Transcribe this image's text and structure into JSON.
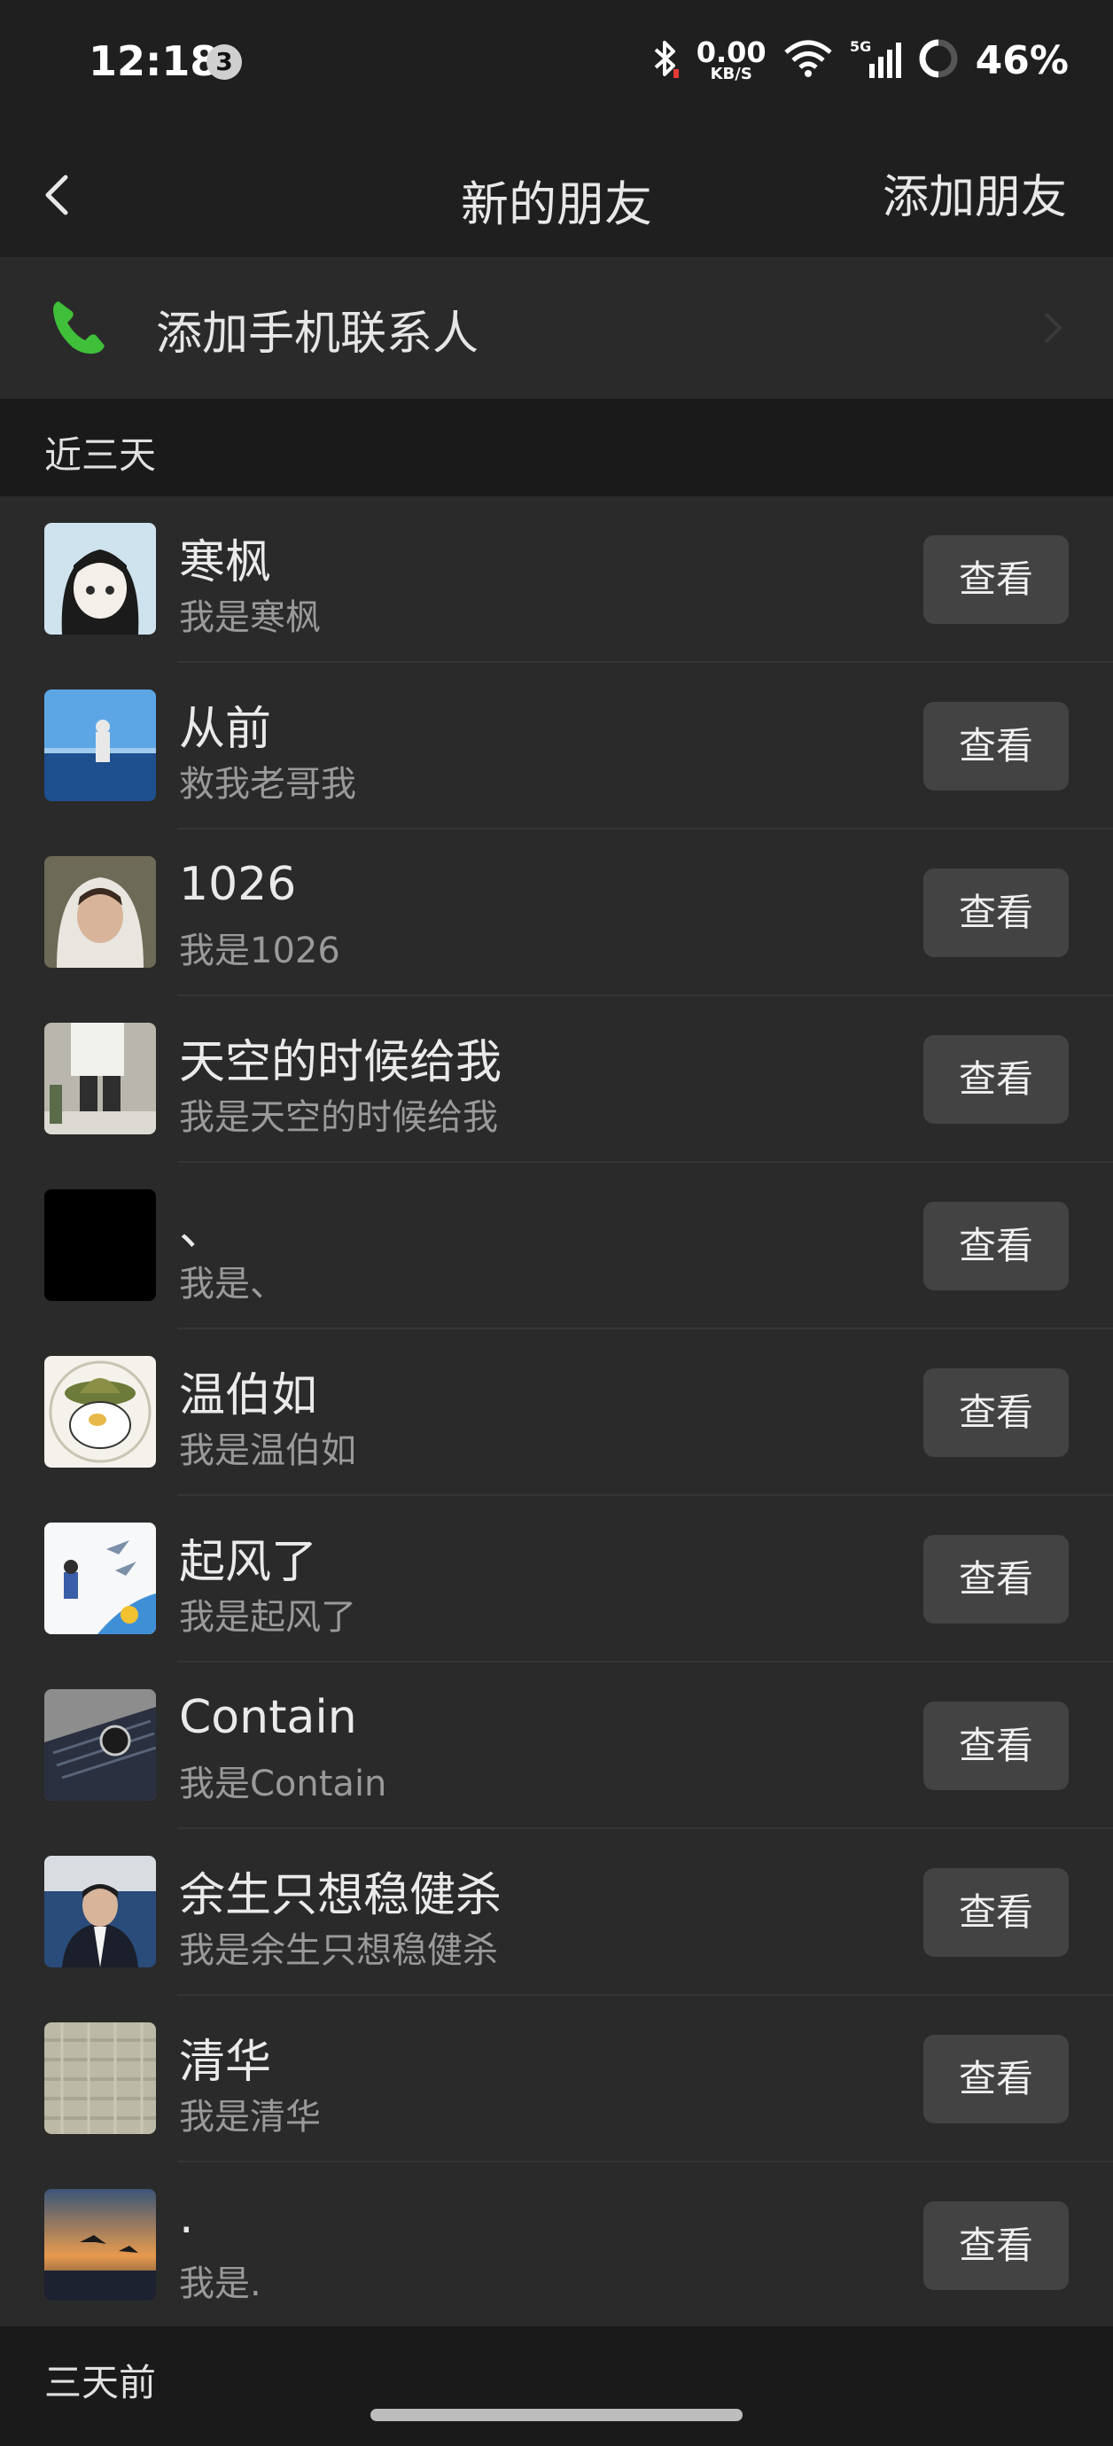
{
  "status_bar": {
    "time": "12:18",
    "notification_count": "3",
    "net_speed_value": "0.00",
    "net_speed_unit": "KB/S",
    "network_type": "5G",
    "battery": "46%"
  },
  "header": {
    "title": "新的朋友",
    "action": "添加朋友"
  },
  "add_contacts": {
    "label": "添加手机联系人"
  },
  "sections": {
    "recent_label": "近三天",
    "older_label": "三天前"
  },
  "requests": [
    {
      "name": "寒枫",
      "note": "我是寒枫",
      "button": "查看"
    },
    {
      "name": "从前",
      "note": "救我老哥我",
      "button": "查看"
    },
    {
      "name": "1026",
      "note": "我是1026",
      "button": "查看"
    },
    {
      "name": "天空的时候给我",
      "note": "我是天空的时候给我",
      "button": "查看"
    },
    {
      "name": "、",
      "note": "我是、",
      "button": "查看"
    },
    {
      "name": "温伯如",
      "note": "我是温伯如",
      "button": "查看"
    },
    {
      "name": "起风了",
      "note": "我是起风了",
      "button": "查看"
    },
    {
      "name": "Contain",
      "note": "我是Contain",
      "button": "查看"
    },
    {
      "name": "余生只想稳健杀",
      "note": "我是余生只想稳健杀",
      "button": "查看"
    },
    {
      "name": "清华",
      "note": "我是清华",
      "button": "查看"
    },
    {
      "name": ".",
      "note": "我是.",
      "button": "查看"
    }
  ],
  "colors": {
    "background": "#1f1f1f",
    "list_background": "#2a2a2a",
    "button_background": "#434343",
    "phone_icon": "#3fbf3a"
  }
}
